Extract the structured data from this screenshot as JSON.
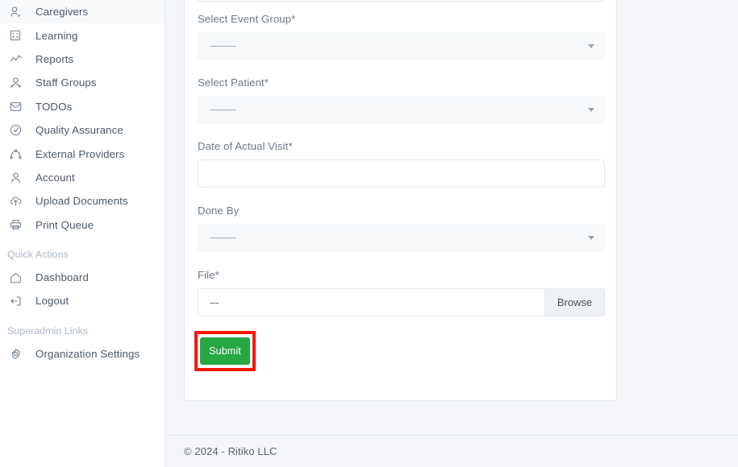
{
  "sidebar": {
    "items": [
      {
        "label": "Caregivers",
        "icon": "user-check-icon"
      },
      {
        "label": "Learning",
        "icon": "calculator-icon"
      },
      {
        "label": "Reports",
        "icon": "line-chart-icon"
      },
      {
        "label": "Staff Groups",
        "icon": "user-group-icon"
      },
      {
        "label": "TODOs",
        "icon": "inbox-icon"
      },
      {
        "label": "Quality Assurance",
        "icon": "check-circle-icon"
      },
      {
        "label": "External Providers",
        "icon": "sitemap-icon"
      },
      {
        "label": "Account",
        "icon": "user-icon"
      },
      {
        "label": "Upload Documents",
        "icon": "cloud-upload-icon"
      },
      {
        "label": "Print Queue",
        "icon": "printer-icon"
      }
    ],
    "quick_actions_header": "Quick Actions",
    "quick_actions": [
      {
        "label": "Dashboard",
        "icon": "home-icon"
      },
      {
        "label": "Logout",
        "icon": "logout-icon"
      }
    ],
    "superadmin_header": "Superadmin Links",
    "superadmin_links": [
      {
        "label": "Organization Settings",
        "icon": "gear-icon"
      }
    ]
  },
  "form": {
    "description_textarea": {
      "value": ""
    },
    "fields": [
      {
        "label": "Select Event Group*",
        "type": "select",
        "value": "---------"
      },
      {
        "label": "Select Patient*",
        "type": "select",
        "value": "---------"
      },
      {
        "label": "Date of Actual Visit*",
        "type": "text",
        "value": "",
        "placeholder": ""
      },
      {
        "label": "Done By",
        "type": "select",
        "value": "---------"
      },
      {
        "label": "File*",
        "type": "file",
        "value": "---",
        "button": "Browse"
      }
    ],
    "submit_label": "Submit"
  },
  "annotation": {
    "highlight_color": "#fb1508",
    "target": "submit-button"
  },
  "theme": {
    "accent_green": "#28a745",
    "page_bg": "#f4f6f9",
    "sidebar_bg": "#ffffff",
    "label_color": "#6c7a89"
  },
  "footer": {
    "copyright": "© 2024 - Ritiko LLC"
  }
}
